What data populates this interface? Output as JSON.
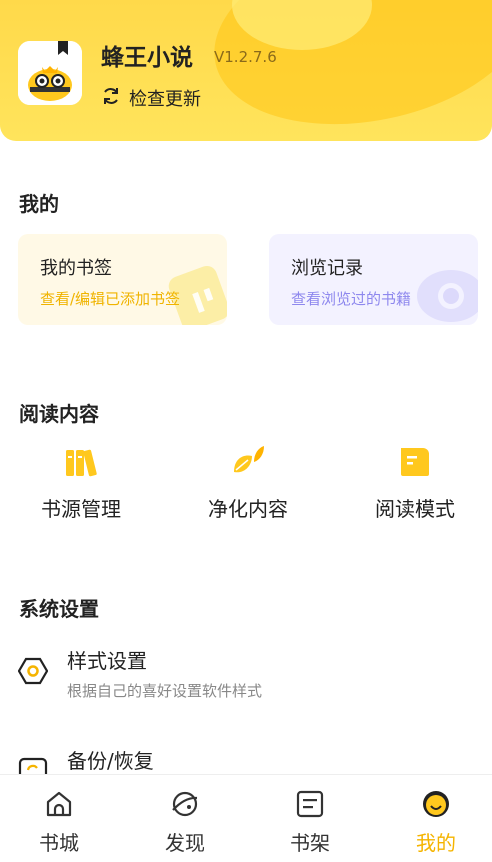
{
  "header": {
    "app_name": "蜂王小说",
    "version": "V1.2.7.6",
    "update_label": "检查更新"
  },
  "mine": {
    "title": "我的",
    "cards": [
      {
        "title": "我的书签",
        "subtitle": "查看/编辑已添加书签"
      },
      {
        "title": "浏览记录",
        "subtitle": "查看浏览过的书籍"
      }
    ]
  },
  "reading": {
    "title": "阅读内容",
    "items": [
      {
        "label": "书源管理",
        "icon": "books-icon"
      },
      {
        "label": "净化内容",
        "icon": "leaf-icon"
      },
      {
        "label": "阅读模式",
        "icon": "book-open-icon"
      }
    ]
  },
  "settings": {
    "title": "系统设置",
    "items": [
      {
        "title": "样式设置",
        "subtitle": "根据自己的喜好设置软件样式",
        "icon": "hexagon-settings-icon"
      },
      {
        "title": "备份/恢复",
        "subtitle": "",
        "icon": "backup-icon"
      }
    ]
  },
  "bottom_nav": {
    "items": [
      {
        "label": "书城",
        "icon": "home-icon",
        "active": false
      },
      {
        "label": "发现",
        "icon": "planet-icon",
        "active": false
      },
      {
        "label": "书架",
        "icon": "shelf-icon",
        "active": false
      },
      {
        "label": "我的",
        "icon": "bee-face-icon",
        "active": true
      }
    ]
  },
  "colors": {
    "accent": "#f5b400",
    "header_bg": "#ffdd4d",
    "bookmark_card_bg": "#fff9e6",
    "history_card_bg": "#f3f2ff",
    "history_accent": "#8e88ee"
  }
}
